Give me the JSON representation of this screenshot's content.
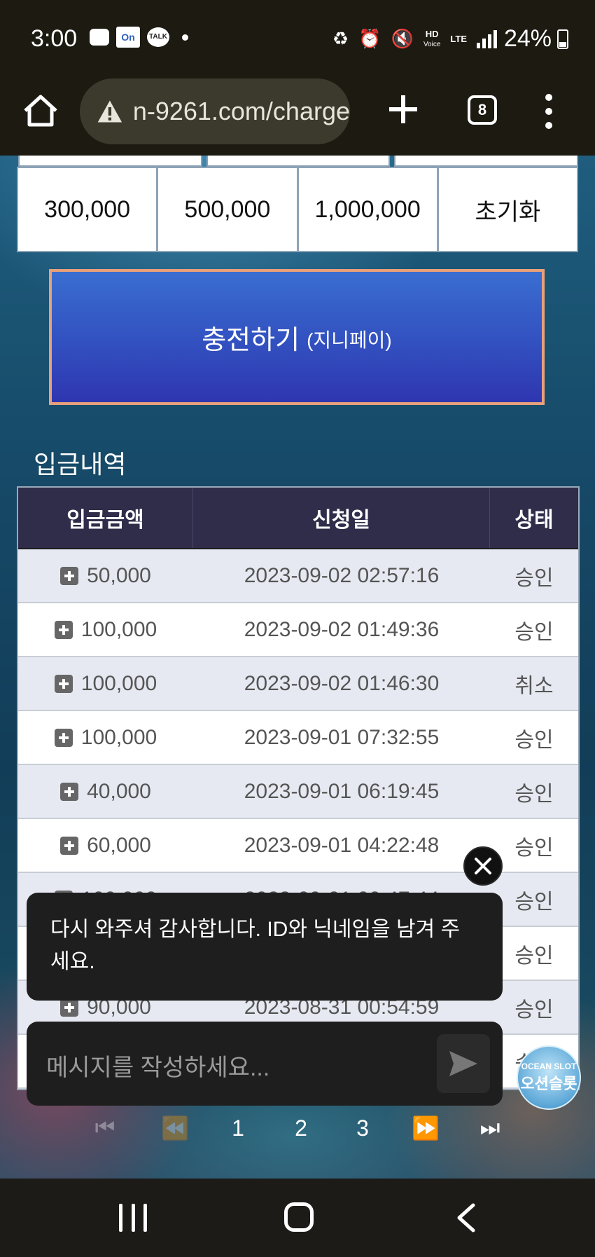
{
  "status_bar": {
    "time": "3:00",
    "notification_icons": [
      "chat-icon",
      "app-icon",
      "talk-icon",
      "dot-icon"
    ],
    "box_icon_text": "On",
    "talk_icon_text": "TALK",
    "hd_label": "HD",
    "voice_label": "Voice",
    "lte_label": "LTE",
    "battery_percent": "24%"
  },
  "browser": {
    "url": "n-9261.com/charge",
    "tab_count": "8"
  },
  "amount_buttons": [
    "300,000",
    "500,000",
    "1,000,000",
    "초기화"
  ],
  "charge_button": {
    "label": "충전하기",
    "sub_label": "(지니페이)"
  },
  "deposit_history": {
    "title": "입금내역",
    "columns": [
      "입금금액",
      "신청일",
      "상태"
    ],
    "rows": [
      {
        "amount": "50,000",
        "date": "2023-09-02 02:57:16",
        "status": "승인"
      },
      {
        "amount": "100,000",
        "date": "2023-09-02 01:49:36",
        "status": "승인"
      },
      {
        "amount": "100,000",
        "date": "2023-09-02 01:46:30",
        "status": "취소"
      },
      {
        "amount": "100,000",
        "date": "2023-09-01 07:32:55",
        "status": "승인"
      },
      {
        "amount": "40,000",
        "date": "2023-09-01 06:19:45",
        "status": "승인"
      },
      {
        "amount": "60,000",
        "date": "2023-09-01 04:22:48",
        "status": "승인"
      },
      {
        "amount": "100,000",
        "date": "2023-09-01 00:47:44",
        "status": "승인"
      },
      {
        "amount": "",
        "date": "",
        "status": "승인"
      },
      {
        "amount": "90,000",
        "date": "2023-08-31 00:54:59",
        "status": "승인"
      },
      {
        "amount": "",
        "date": "",
        "status": "승인"
      }
    ]
  },
  "pagination": {
    "pages": [
      "1",
      "2",
      "3"
    ]
  },
  "chat": {
    "message": "다시 와주셔 감사합니다. ID와 닉네임을 남겨 주세요.",
    "input_placeholder": "메시지를 작성하세요...",
    "logo_en": "OCEAN SLOT",
    "logo_ko": "오션슬롯"
  },
  "colors": {
    "table_header_bg": "#2f2d4a",
    "charge_button_border": "#e8a07a",
    "charge_button_bg": "#3250c0"
  }
}
